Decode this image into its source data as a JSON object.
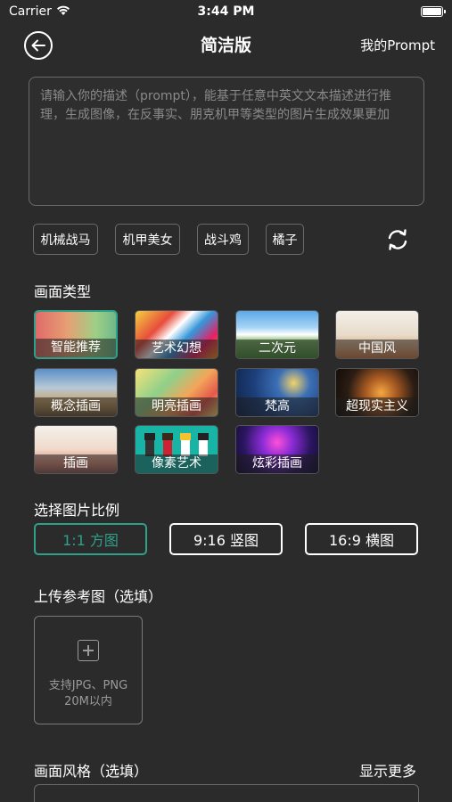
{
  "status_bar": {
    "carrier": "Carrier",
    "time": "3:44 PM"
  },
  "nav": {
    "title": "简洁版",
    "my_prompt": "我的Prompt"
  },
  "prompt": {
    "placeholder": "请输入你的描述（prompt），能基于任意中英文文本描述进行推理，生成图像，在反事实、朋克机甲等类型的图片生成效果更加",
    "value": ""
  },
  "suggestions": [
    "机械战马",
    "机甲美女",
    "战斗鸡",
    "橘子"
  ],
  "picture_type": {
    "label": "画面类型",
    "items": [
      {
        "label": "智能推荐",
        "selected": true
      },
      {
        "label": "艺术幻想",
        "selected": false
      },
      {
        "label": "二次元",
        "selected": false
      },
      {
        "label": "中国风",
        "selected": false
      },
      {
        "label": "概念插画",
        "selected": false
      },
      {
        "label": "明亮插画",
        "selected": false
      },
      {
        "label": "梵高",
        "selected": false
      },
      {
        "label": "超现实主义",
        "selected": false
      },
      {
        "label": "插画",
        "selected": false
      },
      {
        "label": "像素艺术",
        "selected": false
      },
      {
        "label": "炫彩插画",
        "selected": false
      }
    ]
  },
  "ratio": {
    "label": "选择图片比例",
    "options": [
      {
        "label": "1:1 方图",
        "selected": true
      },
      {
        "label": "9:16 竖图",
        "selected": false
      },
      {
        "label": "16:9 横图",
        "selected": false
      }
    ]
  },
  "upload": {
    "label": "上传参考图（选填）",
    "hint_line1": "支持JPG、PNG",
    "hint_line2": "20M以内"
  },
  "style": {
    "label": "画面风格（选填）",
    "show_more": "显示更多"
  },
  "colors": {
    "accent": "#2fa08a",
    "background": "#2b2b2b"
  }
}
